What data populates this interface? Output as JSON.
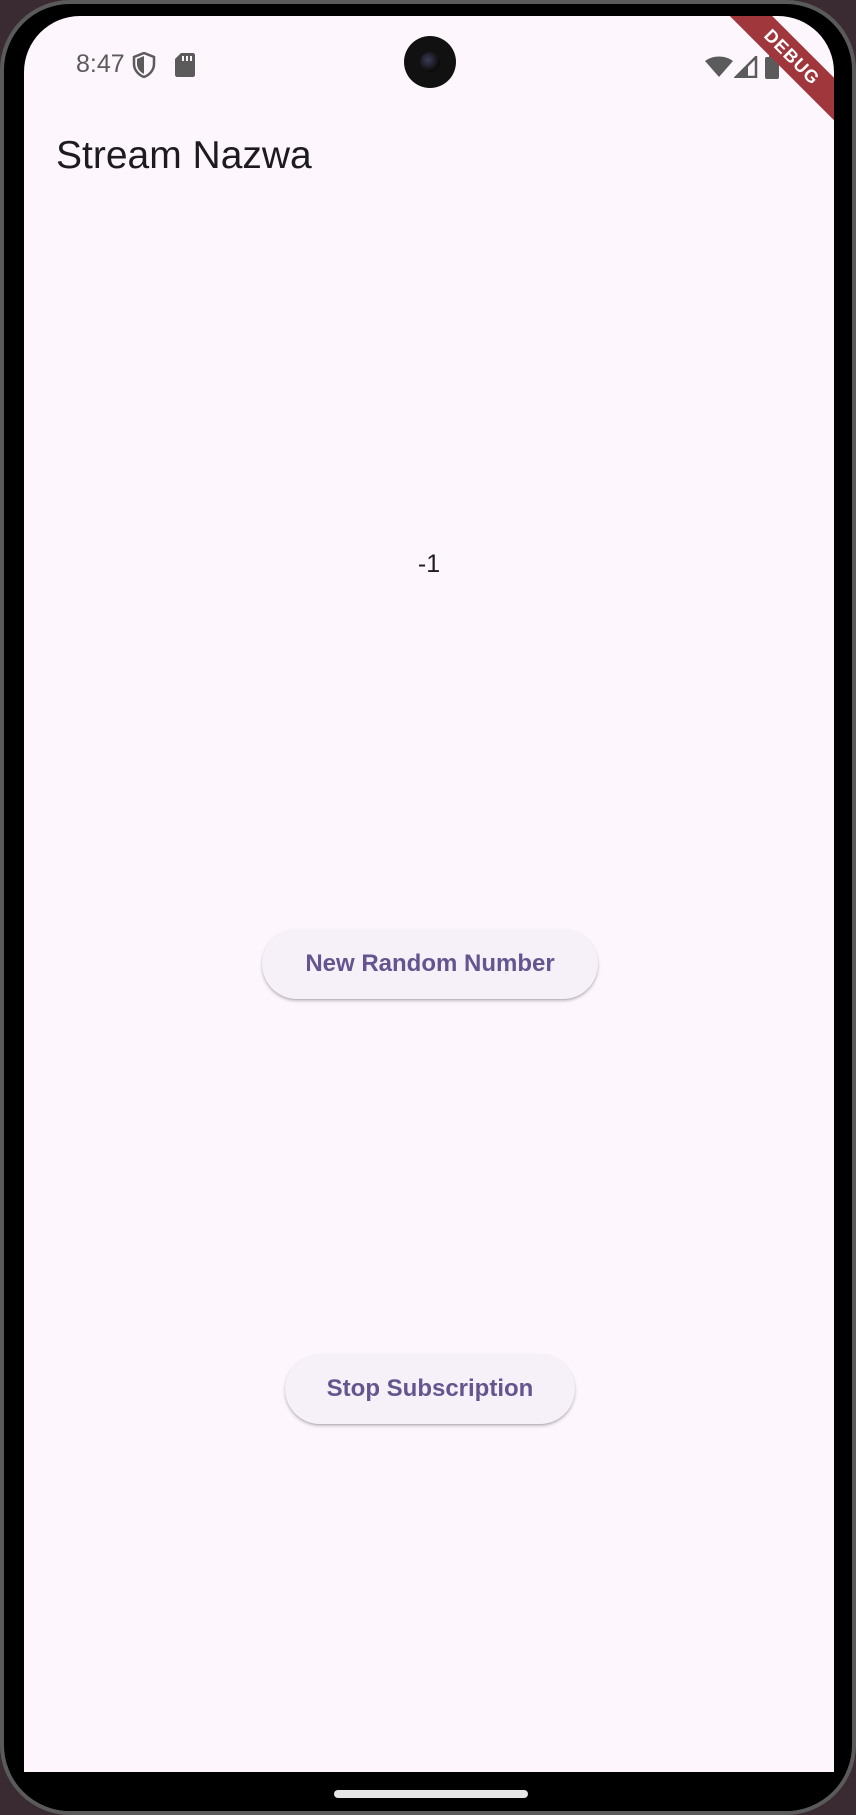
{
  "status_bar": {
    "time": "8:47",
    "icons_left": [
      "shield-icon",
      "sd-card-icon"
    ],
    "icons_right": [
      "wifi-icon",
      "cellular-signal-icon",
      "battery-icon"
    ]
  },
  "debug_banner": "DEBUG",
  "app_bar": {
    "title": "Stream Nazwa"
  },
  "main": {
    "number": "-1",
    "random_button_label": "New Random Number",
    "stop_button_label": "Stop Subscription"
  },
  "colors": {
    "background": "#fdf7fd",
    "button_text": "#65558f",
    "button_bg": "#f6f1f8",
    "debug_banner": "#a0373d"
  }
}
